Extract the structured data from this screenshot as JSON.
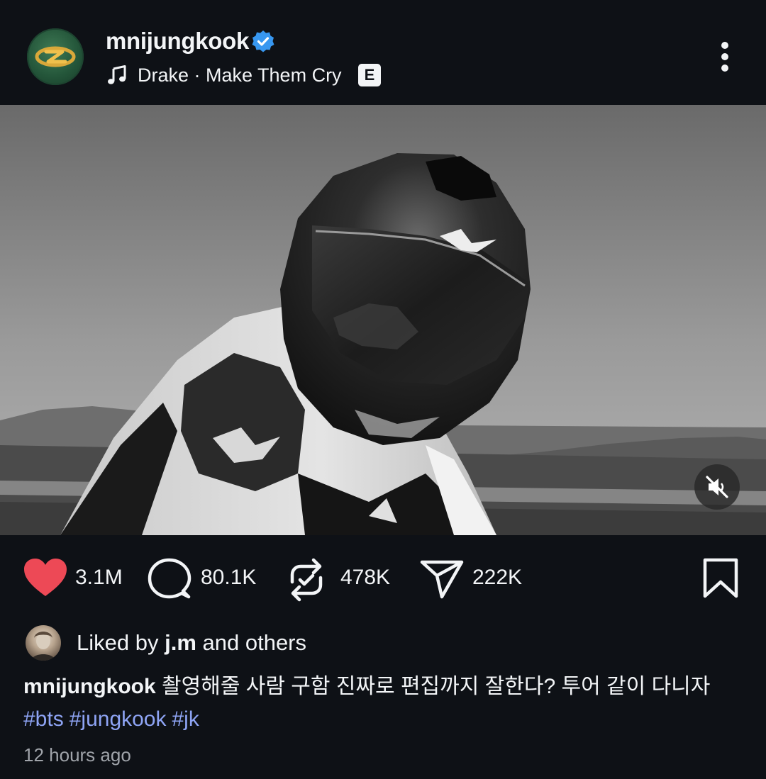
{
  "post": {
    "username": "mnijungkook",
    "verified": true,
    "music": {
      "text": "Drake · Make Them Cry",
      "explicit_badge": "E"
    }
  },
  "media": {
    "type": "video",
    "muted": true
  },
  "actions": {
    "likes": "3.1M",
    "comments": "80.1K",
    "reposts": "478K",
    "shares": "222K"
  },
  "liked_by": {
    "prefix": "Liked by",
    "user": "j.m",
    "suffix": "and others"
  },
  "caption": {
    "author": "mnijungkook",
    "text": "촬영해줄 사람 구함 진짜로 편집까지 잘한다? 투어 같이 다니자",
    "hashtags": [
      "#bts",
      "#jungkook",
      "#jk"
    ]
  },
  "timestamp": "12 hours ago",
  "colors": {
    "background": "#0e1116",
    "like_red": "#ed4956",
    "verified_blue": "#3797f0",
    "hashtag": "#8ea4f4",
    "muted_text": "#a0a4aa"
  },
  "icons": [
    "verified-badge-icon",
    "music-note-icon",
    "more-icon",
    "muted-speaker-icon",
    "heart-icon",
    "comment-icon",
    "repost-icon",
    "share-icon",
    "bookmark-icon"
  ]
}
